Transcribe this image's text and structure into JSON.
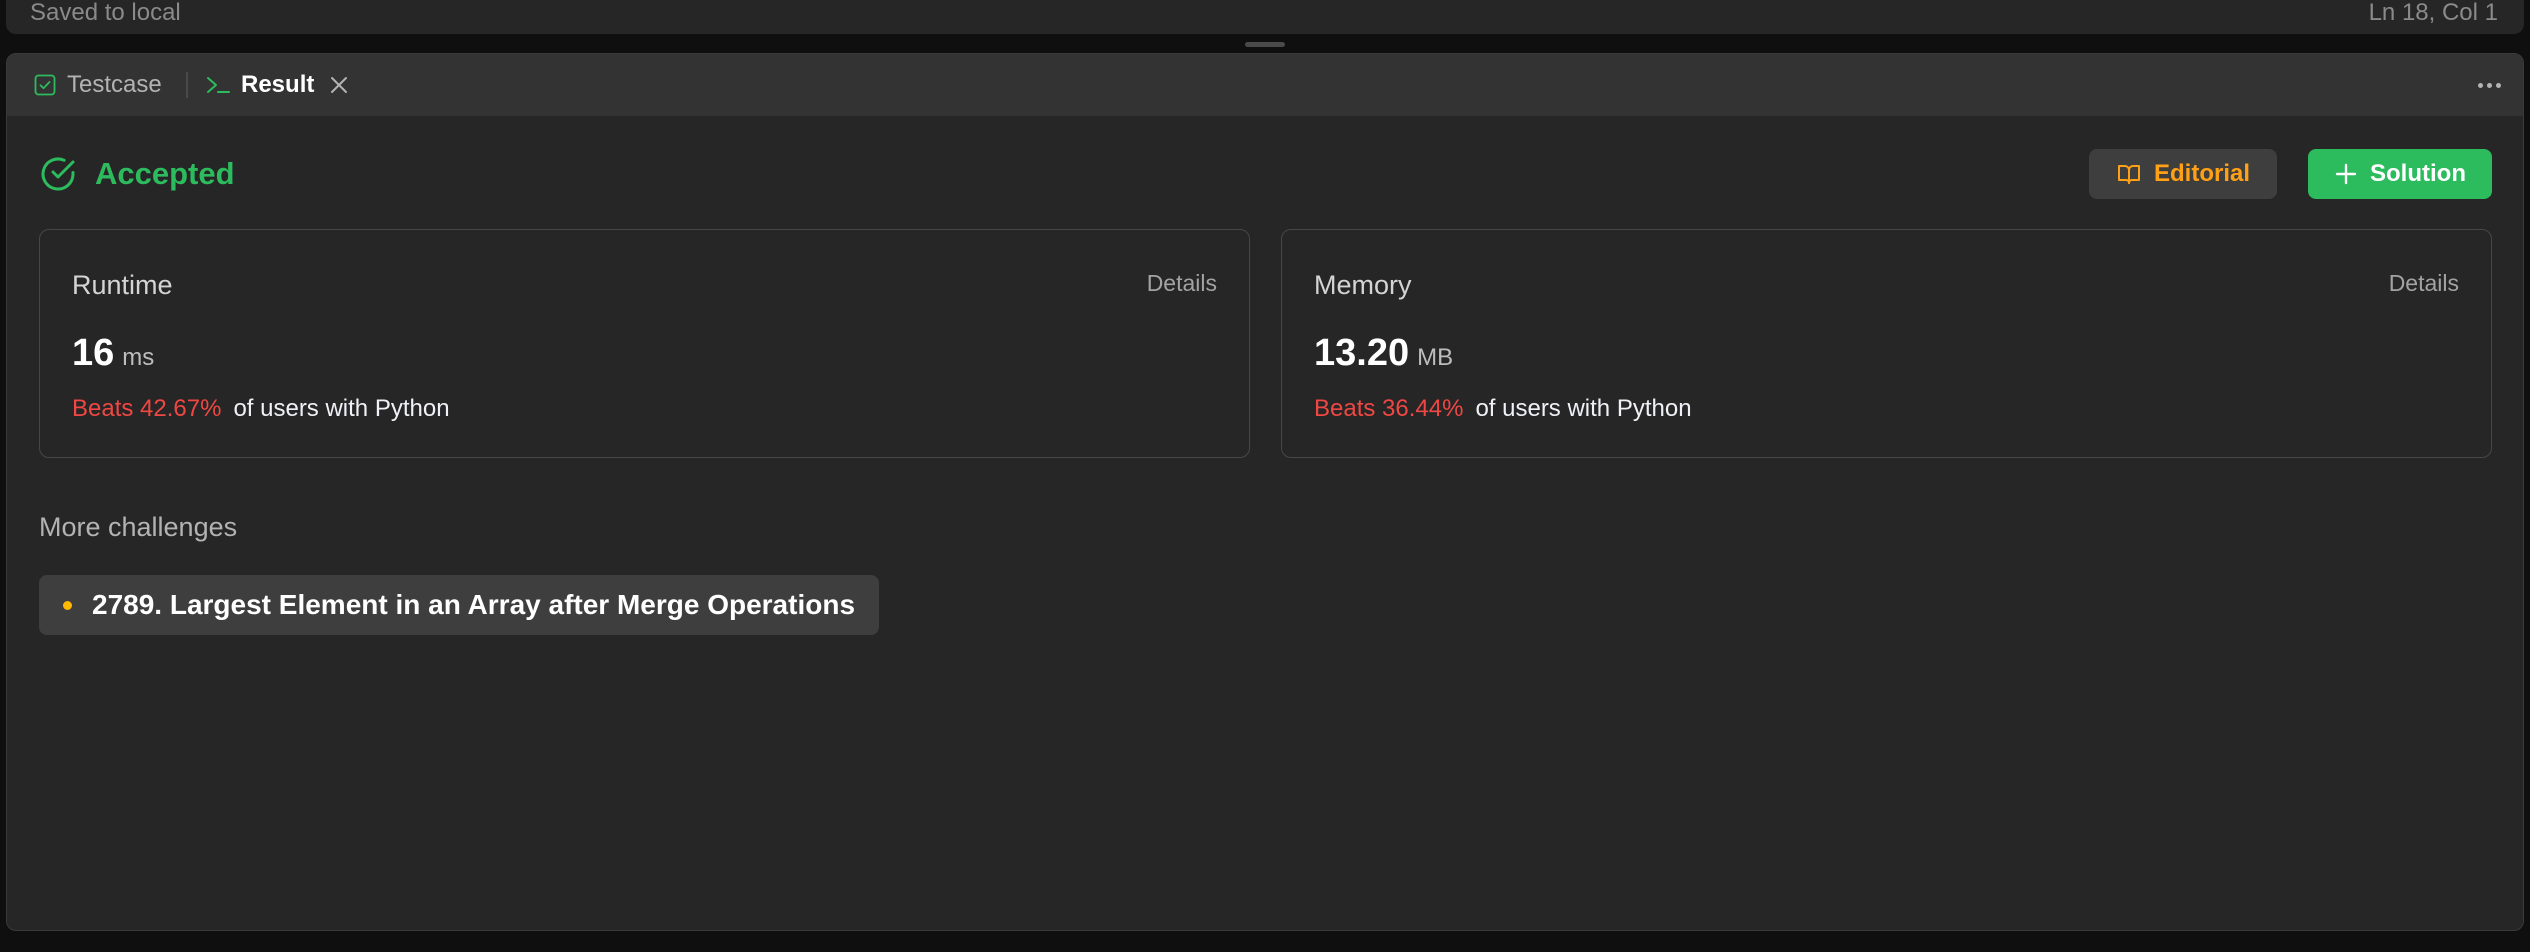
{
  "editor": {
    "save_status": "Saved to local",
    "cursor_position": "Ln 18, Col 1"
  },
  "tabs": [
    {
      "label": "Testcase",
      "icon": "checkbox-icon",
      "active": false
    },
    {
      "label": "Result",
      "icon": "terminal-icon",
      "active": true
    }
  ],
  "result": {
    "status": "Accepted",
    "status_color": "#2cbb5d",
    "editorial_label": "Editorial",
    "solution_label": "Solution"
  },
  "metrics": {
    "runtime": {
      "label": "Runtime",
      "details_label": "Details",
      "value": "16",
      "unit": "ms",
      "beats": "Beats 42.67%",
      "suffix": "of users with Python"
    },
    "memory": {
      "label": "Memory",
      "details_label": "Details",
      "value": "13.20",
      "unit": "MB",
      "beats": "Beats 36.44%",
      "suffix": "of users with Python"
    }
  },
  "more_challenges": {
    "title": "More challenges",
    "items": [
      {
        "label": "2789. Largest Element in an Array after Merge Operations",
        "difficulty_color": "#ffb800"
      }
    ]
  },
  "colors": {
    "accent_green": "#2cbb5d",
    "accent_orange": "#ffa116",
    "beats_red": "#ef4743"
  }
}
